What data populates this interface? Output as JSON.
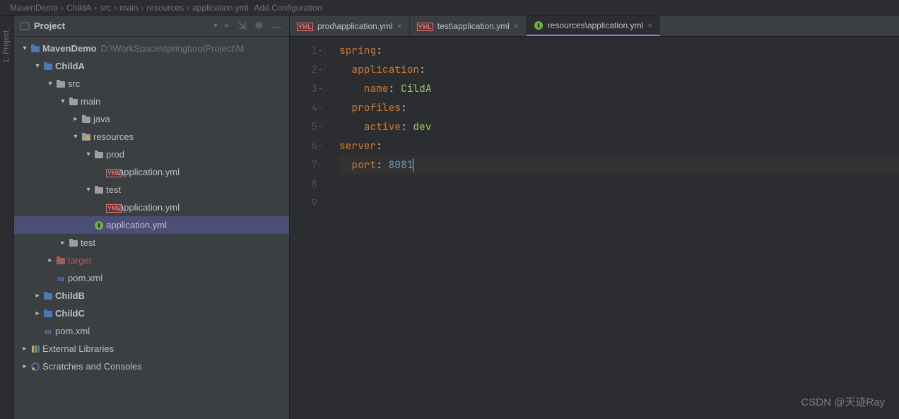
{
  "breadcrumb": [
    "MavenDemo",
    "ChildA",
    "src",
    "main",
    "resources",
    "application.yml"
  ],
  "top_right": "Add Configuration",
  "side_tab": "1: Project",
  "panel": {
    "title": "Project",
    "tools": {
      "locate": "⌖",
      "collapse": "⇲",
      "settings": "✻",
      "hide": "—"
    }
  },
  "tree": [
    {
      "d": 0,
      "chev": "▾",
      "ico": "module",
      "lbl": "MavenDemo",
      "dim": "D:\\WorkSpace\\springbootProject\\M",
      "bold": true
    },
    {
      "d": 1,
      "chev": "▾",
      "ico": "module",
      "lbl": "ChildA",
      "bold": true
    },
    {
      "d": 2,
      "chev": "▾",
      "ico": "folder",
      "lbl": "src"
    },
    {
      "d": 3,
      "chev": "▾",
      "ico": "folder",
      "lbl": "main"
    },
    {
      "d": 4,
      "chev": "▸",
      "ico": "folder",
      "lbl": "java"
    },
    {
      "d": 4,
      "chev": "▾",
      "ico": "res-folder",
      "lbl": "resources"
    },
    {
      "d": 5,
      "chev": "▾",
      "ico": "folder",
      "lbl": "prod"
    },
    {
      "d": 6,
      "chev": "",
      "ico": "yml",
      "lbl": "application.yml"
    },
    {
      "d": 5,
      "chev": "▾",
      "ico": "folder",
      "lbl": "test"
    },
    {
      "d": 6,
      "chev": "",
      "ico": "yml",
      "lbl": "application.yml"
    },
    {
      "d": 5,
      "chev": "",
      "ico": "spring",
      "lbl": "application.yml",
      "selected": true
    },
    {
      "d": 3,
      "chev": "▸",
      "ico": "folder",
      "lbl": "test"
    },
    {
      "d": 2,
      "chev": "▸",
      "ico": "excluded",
      "lbl": "target",
      "excluded": true
    },
    {
      "d": 2,
      "chev": "",
      "ico": "maven",
      "lbl": "pom.xml"
    },
    {
      "d": 1,
      "chev": "▸",
      "ico": "module",
      "lbl": "ChildB",
      "bold": true
    },
    {
      "d": 1,
      "chev": "▸",
      "ico": "module",
      "lbl": "ChildC",
      "bold": true
    },
    {
      "d": 1,
      "chev": "",
      "ico": "maven",
      "lbl": "pom.xml"
    },
    {
      "d": 0,
      "chev": "▸",
      "ico": "lib",
      "lbl": "External Libraries"
    },
    {
      "d": 0,
      "chev": "▸",
      "ico": "scratch",
      "lbl": "Scratches and Consoles"
    }
  ],
  "tabs": [
    {
      "ico": "yml",
      "lbl": "prod\\application.yml",
      "active": false
    },
    {
      "ico": "yml",
      "lbl": "test\\application.yml",
      "active": false
    },
    {
      "ico": "spring",
      "lbl": "resources\\application.yml",
      "active": true
    }
  ],
  "code": {
    "lines": [
      [
        {
          "t": "spring",
          "c": "key"
        },
        {
          "t": ":",
          "c": ""
        }
      ],
      [
        {
          "t": "  application",
          "c": "key"
        },
        {
          "t": ":",
          "c": ""
        }
      ],
      [
        {
          "t": "    name",
          "c": "key"
        },
        {
          "t": ": ",
          "c": ""
        },
        {
          "t": "CildA",
          "c": "val"
        }
      ],
      [
        {
          "t": "  profiles",
          "c": "key"
        },
        {
          "t": ":",
          "c": ""
        }
      ],
      [
        {
          "t": "    active",
          "c": "key"
        },
        {
          "t": ": ",
          "c": ""
        },
        {
          "t": "dev",
          "c": "val"
        }
      ],
      [
        {
          "t": "server",
          "c": "key"
        },
        {
          "t": ":",
          "c": ""
        }
      ],
      [
        {
          "t": "  port",
          "c": "key"
        },
        {
          "t": ": ",
          "c": ""
        },
        {
          "t": "8081",
          "c": "num"
        }
      ],
      [],
      []
    ],
    "cursor_line": 7
  },
  "watermark": "CSDN @天迹Ray"
}
